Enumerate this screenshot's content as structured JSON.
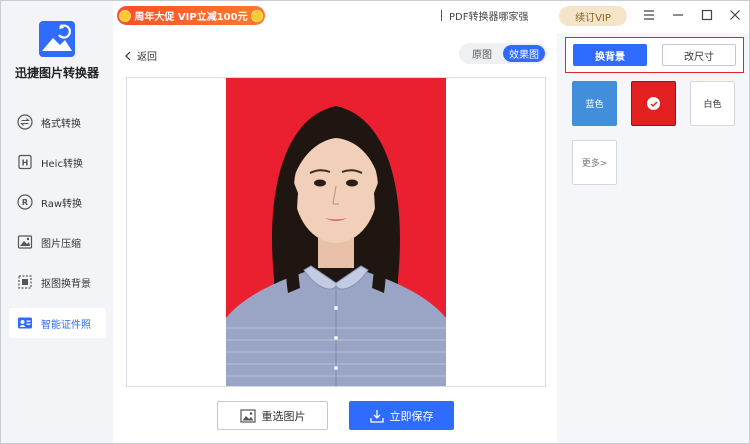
{
  "app": {
    "name": "迅捷图片转换器"
  },
  "sidebar": {
    "items": [
      {
        "label": "格式转换",
        "icon": "format-convert-icon"
      },
      {
        "label": "Heic转换",
        "icon": "heic-icon"
      },
      {
        "label": "Raw转换",
        "icon": "raw-icon"
      },
      {
        "label": "图片压缩",
        "icon": "image-compress-icon"
      },
      {
        "label": "抠图换背景",
        "icon": "cutout-icon"
      },
      {
        "label": "智能证件照",
        "icon": "id-photo-icon",
        "active": true
      }
    ]
  },
  "topbar": {
    "promo": "周年大促 VIP立减100元",
    "pdf_link": "PDF转换器哪家强",
    "vip_button": "续订VIP"
  },
  "main": {
    "back": "返回",
    "view_toggle": [
      "原图",
      "效果图"
    ],
    "reselect_button": "重选图片",
    "save_button": "立即保存"
  },
  "right_panel": {
    "tabs": [
      "换背景",
      "改尺寸"
    ],
    "swatches": [
      {
        "label": "蓝色",
        "color": "#438edb"
      },
      {
        "label": "",
        "color": "#e1201f",
        "selected": true
      },
      {
        "label": "白色",
        "color": "#ffffff"
      }
    ],
    "more": "更多>"
  },
  "colors": {
    "accent": "#2f6bff",
    "photo_background": "#ea1f30",
    "highlight_border": "#e0262e"
  }
}
